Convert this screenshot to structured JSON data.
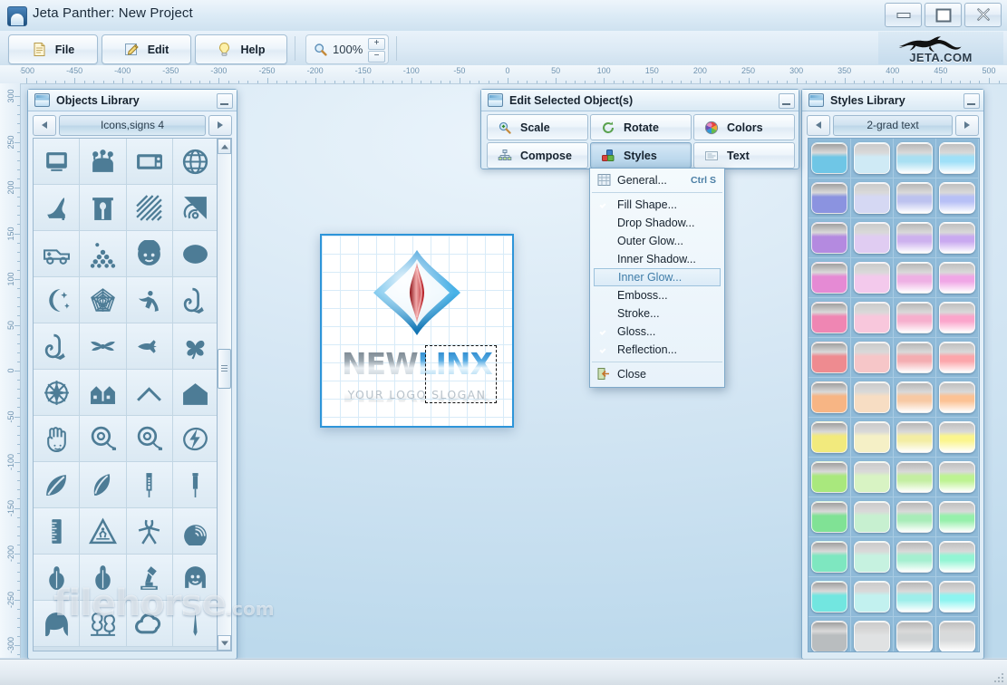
{
  "window": {
    "title": "Jeta Panther: New Project",
    "app_icon": "jeta-panther-icon",
    "controls": {
      "minimize": "minimize",
      "restore": "restore",
      "close": "close"
    }
  },
  "toolbar": {
    "buttons": [
      {
        "label": "File",
        "icon": "file-icon"
      },
      {
        "label": "Edit",
        "icon": "edit-pencil-icon"
      },
      {
        "label": "Help",
        "icon": "lightbulb-icon"
      }
    ],
    "zoom": {
      "value": "100%",
      "icon": "magnifier-icon",
      "increase": "+",
      "decrease": "−"
    },
    "brand": {
      "text": "JETA.COM",
      "icon": "panther-logo-icon"
    }
  },
  "rulers": {
    "horizontal": [
      "-500",
      "-450",
      "-400",
      "-350",
      "-300",
      "-250",
      "-200",
      "-150",
      "-100",
      "-50",
      "0",
      "50",
      "100",
      "150",
      "200",
      "250",
      "300",
      "350",
      "400",
      "450",
      "500"
    ],
    "vertical": [
      "300",
      "250",
      "200",
      "150",
      "100",
      "50",
      "0",
      "-50",
      "-100",
      "-150",
      "-200",
      "-250",
      "-300"
    ],
    "unit_step": 50
  },
  "objects_library": {
    "title": "Objects Library",
    "icon": "library-icon",
    "minimize": "minimize",
    "nav": {
      "prev": "◂",
      "next": "▸",
      "category": "Icons,signs 4"
    },
    "scrollbar": {
      "up": "scroll-up",
      "down": "scroll-down",
      "thumb": "scroll-thumb"
    },
    "icons": [
      "computer",
      "crowd",
      "microwave",
      "globe",
      "high-heel-shoe",
      "shrine-gate",
      "diagonal-stripes",
      "fingerprint",
      "ambulance",
      "ball-pyramid",
      "child-face",
      "ellipse",
      "moon-stars",
      "spiral-web",
      "diver",
      "saxophone",
      "saxophone-2",
      "dragonfly",
      "arrow-fish",
      "four-leaf-clover",
      "compass-rose",
      "houses",
      "roof",
      "house",
      "hand",
      "at-sign-cable",
      "at-sign-cable-2",
      "lightning-bolt",
      "leaf",
      "feather",
      "syringe",
      "needle",
      "ruler",
      "pedestrian-warning-sign",
      "stick-figure",
      "shell",
      "violin",
      "cello",
      "microscope",
      "girl-face",
      "hair",
      "trees",
      "cloud",
      "spire"
    ],
    "watermark": {
      "text": "filehorse",
      "suffix": ".com"
    }
  },
  "styles_library": {
    "title": "Styles Library",
    "icon": "library-icon",
    "minimize": "minimize",
    "nav": {
      "prev": "◂",
      "next": "▸",
      "category": "2-grad text"
    },
    "swatch_rows": [
      {
        "name": "cyan-blue",
        "colors": [
          "#6fc6e6",
          "#cfeaf5",
          "#a9dff2",
          "#9fe0f8"
        ]
      },
      {
        "name": "periwinkle",
        "colors": [
          "#8b93e0",
          "#d5d8f3",
          "#bcc2ef",
          "#b7c0f6"
        ]
      },
      {
        "name": "violet",
        "colors": [
          "#b48ae0",
          "#e0ccf2",
          "#cdb1ee",
          "#c9a9f0"
        ]
      },
      {
        "name": "magenta",
        "colors": [
          "#e58ad4",
          "#f3c9ec",
          "#eeb0e4",
          "#f0a6e6"
        ]
      },
      {
        "name": "pink",
        "colors": [
          "#ef86b3",
          "#f8c7dc",
          "#f6afcd",
          "#fba5cb"
        ]
      },
      {
        "name": "rose",
        "colors": [
          "#ee8b90",
          "#f6c6c8",
          "#f4adb1",
          "#fca6ab"
        ]
      },
      {
        "name": "peach",
        "colors": [
          "#f7b584",
          "#f7ddc3",
          "#f7c9a4",
          "#fcc294"
        ]
      },
      {
        "name": "yellow",
        "colors": [
          "#f2ea7d",
          "#f5f0c6",
          "#f3eda4",
          "#fbf58e"
        ]
      },
      {
        "name": "lime",
        "colors": [
          "#a9e87d",
          "#d8f3c3",
          "#c4eea2",
          "#bdf392"
        ]
      },
      {
        "name": "green",
        "colors": [
          "#80e295",
          "#c7f0d0",
          "#a8ecb8",
          "#96f0ab"
        ]
      },
      {
        "name": "aqua-green",
        "colors": [
          "#7ee7c0",
          "#c6f2e0",
          "#a5efd0",
          "#93f5d4"
        ]
      },
      {
        "name": "turquoise",
        "colors": [
          "#72e6e0",
          "#c2f1ef",
          "#9eeeea",
          "#8df4f0"
        ]
      },
      {
        "name": "grey",
        "colors": [
          "#b9bdbf",
          "#e0e2e3",
          "#cfd2d3",
          "#d8dadb"
        ]
      }
    ]
  },
  "edit_panel": {
    "title": "Edit Selected Object(s)",
    "icon": "edit-panel-icon",
    "minimize": "minimize",
    "buttons": [
      {
        "label": "Scale",
        "icon": "scale-icon",
        "active": false
      },
      {
        "label": "Rotate",
        "icon": "rotate-icon",
        "active": false
      },
      {
        "label": "Colors",
        "icon": "color-wheel-icon",
        "active": false
      },
      {
        "label": "Compose",
        "icon": "compose-icon",
        "active": false
      },
      {
        "label": "Styles",
        "icon": "styles-blocks-icon",
        "active": true
      },
      {
        "label": "Text",
        "icon": "text-icon",
        "active": false
      }
    ]
  },
  "styles_menu": {
    "items": [
      {
        "label": "General...",
        "shortcut": "Ctrl S",
        "icon": "grid-icon",
        "checked": false,
        "selected": false,
        "divider_after": true
      },
      {
        "label": "Fill Shape...",
        "shortcut": "",
        "icon": "check-icon",
        "checked": true,
        "selected": false
      },
      {
        "label": "Drop Shadow...",
        "shortcut": "",
        "icon": "",
        "checked": false,
        "selected": false
      },
      {
        "label": "Outer Glow...",
        "shortcut": "",
        "icon": "",
        "checked": false,
        "selected": false
      },
      {
        "label": "Inner Shadow...",
        "shortcut": "",
        "icon": "",
        "checked": false,
        "selected": false
      },
      {
        "label": "Inner Glow...",
        "shortcut": "",
        "icon": "",
        "checked": false,
        "selected": true
      },
      {
        "label": "Emboss...",
        "shortcut": "",
        "icon": "",
        "checked": false,
        "selected": false
      },
      {
        "label": "Stroke...",
        "shortcut": "",
        "icon": "",
        "checked": false,
        "selected": false
      },
      {
        "label": "Gloss...",
        "shortcut": "",
        "icon": "check-icon",
        "checked": true,
        "selected": false
      },
      {
        "label": "Reflection...",
        "shortcut": "",
        "icon": "check-icon",
        "checked": true,
        "selected": false,
        "divider_after": true
      },
      {
        "label": "Close",
        "shortcut": "",
        "icon": "exit-icon",
        "checked": false,
        "selected": false
      }
    ]
  },
  "canvas": {
    "logo": {
      "mark": "blue-diamond-red-flame-icon",
      "name_part_a": "NEW",
      "name_part_b": "LINX",
      "slogan": "YOUR LOGO SLOGAN",
      "selection": "marquee-selection"
    }
  },
  "colors": {
    "accent": "#2e95d9",
    "panel_border": "#7fa9c9",
    "workspace": "#cfe0ee",
    "icon_fill": "#4d7c96",
    "menu_selected_text": "#3f7ca8"
  }
}
